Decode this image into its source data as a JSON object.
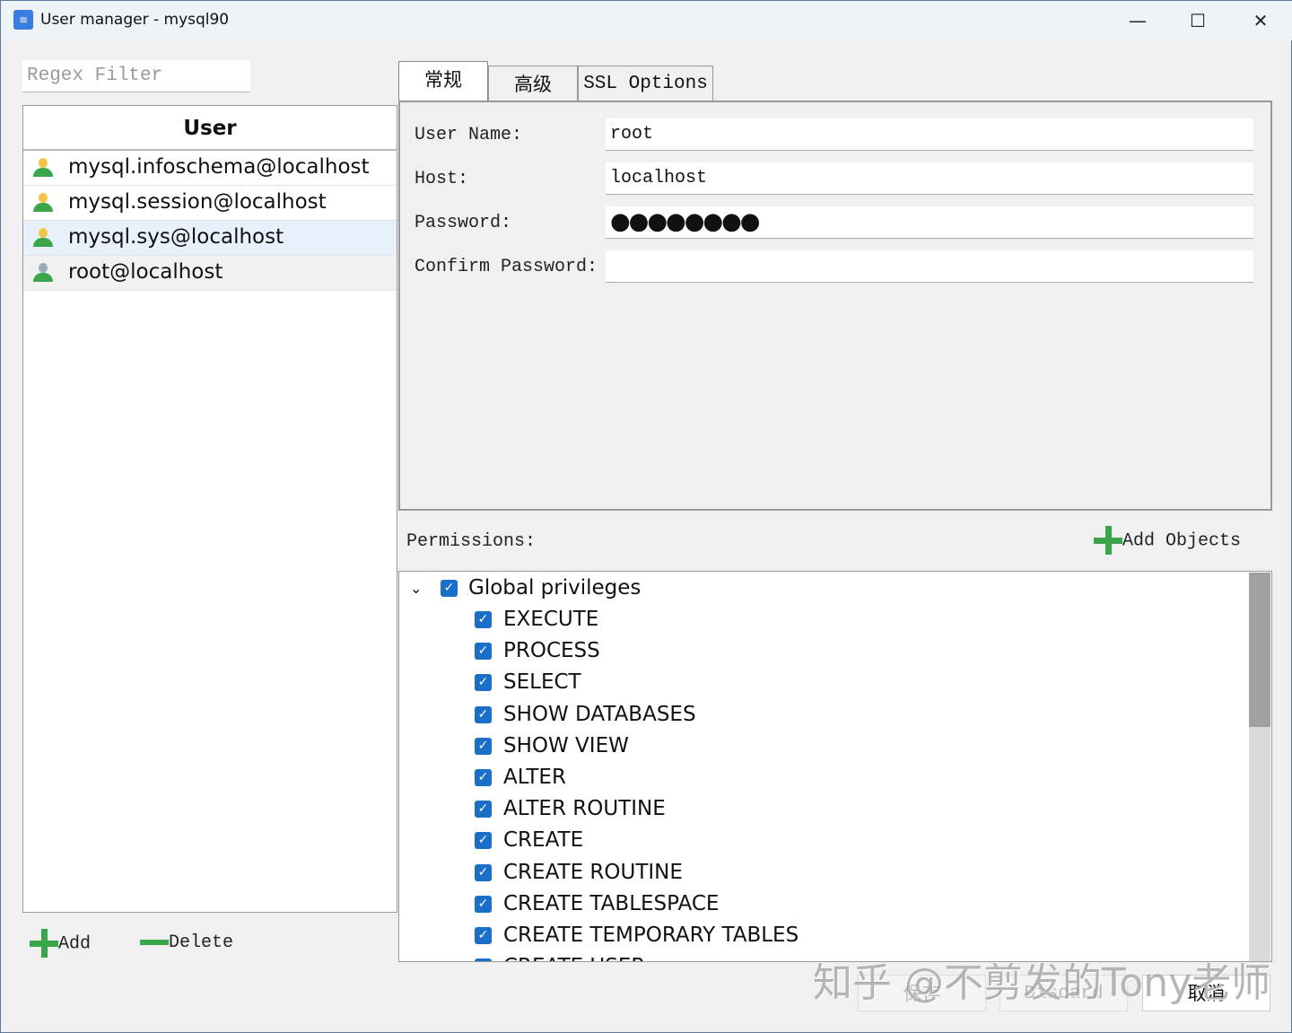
{
  "window": {
    "title": "User manager - mysql90",
    "minimize": "—",
    "maximize": "☐",
    "close": "✕"
  },
  "filter": {
    "placeholder": "Regex Filter"
  },
  "user_list": {
    "header": "User",
    "users": [
      "mysql.infoschema@localhost",
      "mysql.session@localhost",
      "mysql.sys@localhost",
      "root@localhost"
    ]
  },
  "tabs": [
    "常规",
    "高级",
    "SSL Options"
  ],
  "general": {
    "user_name_label": "User Name:",
    "user_name": "root",
    "host_label": "Host:",
    "host": "localhost",
    "password_label": "Password:",
    "password": "●●●●●●●●",
    "confirm_label": "Confirm Password:",
    "confirm": ""
  },
  "permissions": {
    "label": "Permissions:",
    "add_objects": "Add Objects",
    "group": "Global privileges",
    "items": [
      "EXECUTE",
      "PROCESS",
      "SELECT",
      "SHOW DATABASES",
      "SHOW VIEW",
      "ALTER",
      "ALTER ROUTINE",
      "CREATE",
      "CREATE ROUTINE",
      "CREATE TABLESPACE",
      "CREATE TEMPORARY TABLES",
      "CREATE USER"
    ]
  },
  "bottom": {
    "add": "Add",
    "delete": "Delete",
    "save": "保存",
    "discard": "Discard",
    "cancel": "取消"
  },
  "watermark": "知乎 @不剪发的Tony老师"
}
